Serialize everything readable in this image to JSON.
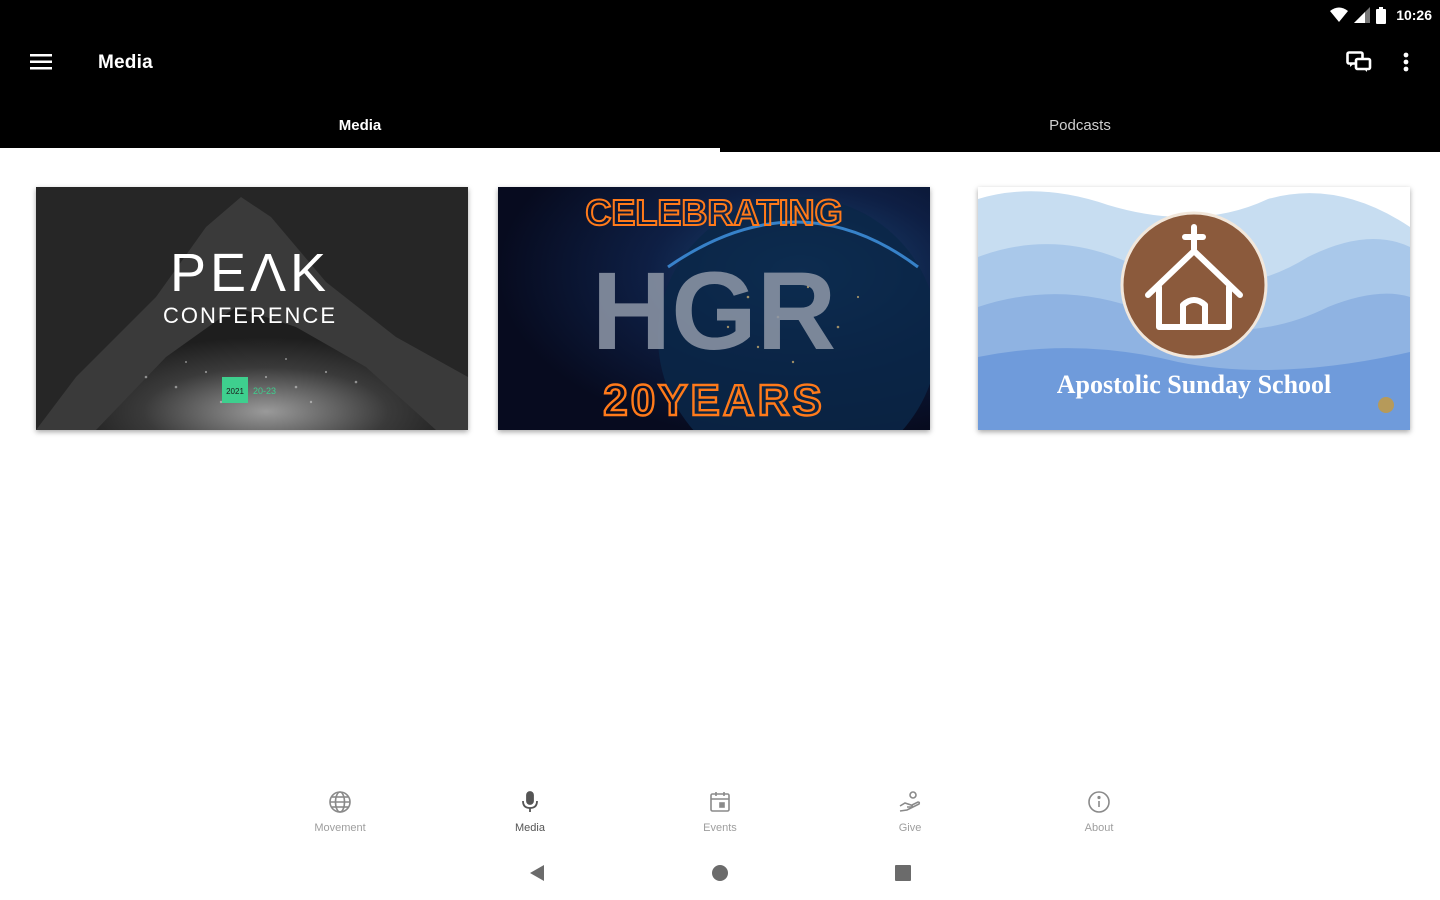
{
  "status_bar": {
    "time": "10:26"
  },
  "app_bar": {
    "title": "Media"
  },
  "tabs": [
    {
      "label": "Media",
      "active": true
    },
    {
      "label": "Podcasts",
      "active": false
    }
  ],
  "media_items": [
    {
      "title_line1": "PEΛK",
      "title_line2": "CONFERENCE",
      "date_badge": "2021",
      "date_suffix": "20-23"
    },
    {
      "title_top": "CELEBRATING",
      "title_mid": "HGR",
      "title_bottom": "20YEARS"
    },
    {
      "title": "Apostolic Sunday School"
    }
  ],
  "bottom_nav": [
    {
      "label": "Movement",
      "icon": "globe-icon"
    },
    {
      "label": "Media",
      "icon": "microphone-icon",
      "active": true
    },
    {
      "label": "Events",
      "icon": "calendar-icon"
    },
    {
      "label": "Give",
      "icon": "give-hand-icon"
    },
    {
      "label": "About",
      "icon": "info-icon"
    }
  ],
  "colors": {
    "bar_bg": "#000000",
    "peak_green": "#3ecf8e",
    "neon_orange": "#ff7a1a",
    "church_brown": "#8b5a3c"
  }
}
